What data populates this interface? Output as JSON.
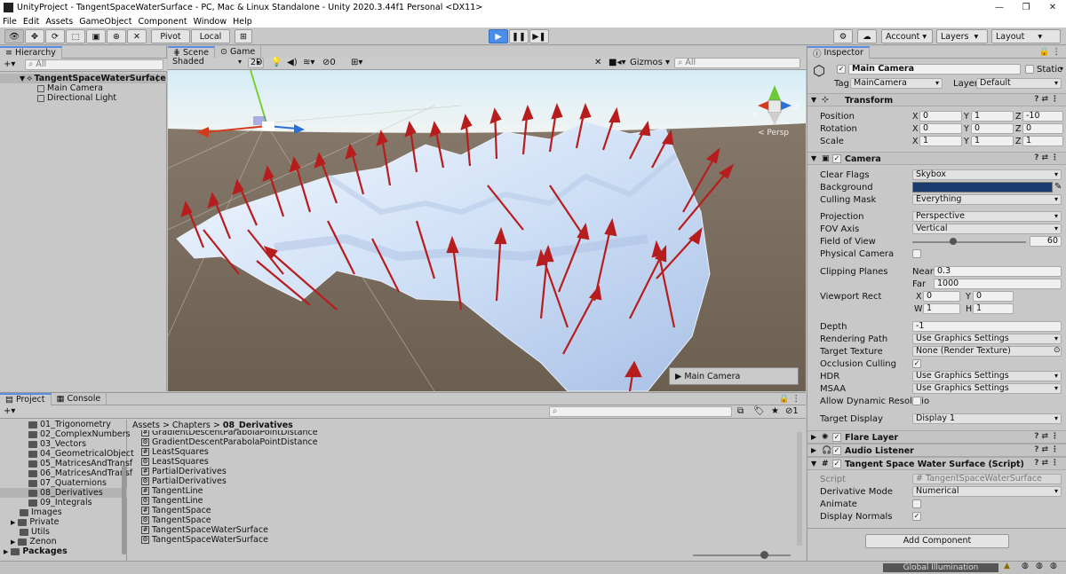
{
  "window": {
    "title": "UnityProject - TangentSpaceWaterSurface - PC, Mac & Linux Standalone - Unity 2020.3.44f1 Personal <DX11>",
    "controls": [
      "—",
      "❐",
      "✕"
    ]
  },
  "menu": [
    "File",
    "Edit",
    "Assets",
    "GameObject",
    "Component",
    "Window",
    "Help"
  ],
  "toolbar": {
    "pivot": "Pivot",
    "local": "Local",
    "account": "Account",
    "layers": "Layers",
    "layout": "Layout"
  },
  "hierarchy": {
    "tab": "Hierarchy",
    "search_placeholder": "All",
    "scene_name": "TangentSpaceWaterSurface",
    "items": [
      "Main Camera",
      "Directional Light"
    ]
  },
  "scene": {
    "tabs": [
      "Scene",
      "Game"
    ],
    "shading": "Shaded",
    "mode_2d": "2D",
    "hidden_count": "0",
    "gizmos": "Gizmos",
    "search_placeholder": "All",
    "persp": "< Persp",
    "camera_preview": "Main Camera",
    "axis_x": "x",
    "axis_z": "z"
  },
  "inspector": {
    "tab": "Inspector",
    "object_name": "Main Camera",
    "static_label": "Static",
    "tag_label": "Tag",
    "tag_value": "MainCamera",
    "layer_label": "Layer",
    "layer_value": "Default",
    "transform": {
      "header": "Transform",
      "position_label": "Position",
      "position": [
        "0",
        "1",
        "-10"
      ],
      "rotation_label": "Rotation",
      "rotation": [
        "0",
        "0",
        "0"
      ],
      "scale_label": "Scale",
      "scale": [
        "1",
        "1",
        "1"
      ],
      "axes": [
        "X",
        "Y",
        "Z"
      ]
    },
    "camera": {
      "header": "Camera",
      "clear_flags_label": "Clear Flags",
      "clear_flags": "Skybox",
      "background_label": "Background",
      "background_color": "#1a3a6e",
      "culling_mask_label": "Culling Mask",
      "culling_mask": "Everything",
      "projection_label": "Projection",
      "projection": "Perspective",
      "fov_axis_label": "FOV Axis",
      "fov_axis": "Vertical",
      "fov_label": "Field of View",
      "fov": "60",
      "physical_label": "Physical Camera",
      "clipping_label": "Clipping Planes",
      "near_label": "Near",
      "near": "0.3",
      "far_label": "Far",
      "far": "1000",
      "viewport_label": "Viewport Rect",
      "vx_label": "X",
      "vx": "0",
      "vy_label": "Y",
      "vy": "0",
      "vw_label": "W",
      "vw": "1",
      "vh_label": "H",
      "vh": "1",
      "depth_label": "Depth",
      "depth": "-1",
      "rendering_path_label": "Rendering Path",
      "rendering_path": "Use Graphics Settings",
      "target_texture_label": "Target Texture",
      "target_texture": "None (Render Texture)",
      "occlusion_label": "Occlusion Culling",
      "hdr_label": "HDR",
      "hdr": "Use Graphics Settings",
      "msaa_label": "MSAA",
      "msaa": "Use Graphics Settings",
      "dyn_res_label": "Allow Dynamic Resolutio",
      "target_display_label": "Target Display",
      "target_display": "Display 1"
    },
    "flare_layer": "Flare Layer",
    "audio_listener": "Audio Listener",
    "script": {
      "header": "Tangent Space Water Surface (Script)",
      "script_label": "Script",
      "script_value": "TangentSpaceWaterSurface",
      "derivative_label": "Derivative Mode",
      "derivative_value": "Numerical",
      "animate_label": "Animate",
      "normals_label": "Display Normals"
    },
    "add_component": "Add Component"
  },
  "project": {
    "tabs": [
      "Project",
      "Console"
    ],
    "folders": [
      "01_Trigonometry",
      "02_ComplexNumbers",
      "03_Vectors",
      "04_GeometricalObject",
      "05_MatricesAndTransf",
      "06_MatricesAndTransf",
      "07_Quaternions",
      "08_Derivatives",
      "09_Integrals"
    ],
    "top_folders": [
      "Images",
      "Private",
      "Utils",
      "Zenon"
    ],
    "packages": "Packages",
    "breadcrumb": [
      "Assets",
      "Chapters",
      "08_Derivatives"
    ],
    "files": [
      {
        "icon": "#",
        "name": "GradientDescentParabolaPointDistance"
      },
      {
        "icon": "⚙",
        "name": "GradientDescentParabolaPointDistance"
      },
      {
        "icon": "#",
        "name": "LeastSquares"
      },
      {
        "icon": "⚙",
        "name": "LeastSquares"
      },
      {
        "icon": "#",
        "name": "PartialDerivatives"
      },
      {
        "icon": "⚙",
        "name": "PartialDerivatives"
      },
      {
        "icon": "#",
        "name": "TangentLine"
      },
      {
        "icon": "⚙",
        "name": "TangentLine"
      },
      {
        "icon": "#",
        "name": "TangentSpace"
      },
      {
        "icon": "⚙",
        "name": "TangentSpace"
      },
      {
        "icon": "#",
        "name": "TangentSpaceWaterSurface"
      },
      {
        "icon": "⚙",
        "name": "TangentSpaceWaterSurface"
      }
    ],
    "hidden_count": "1"
  },
  "status": {
    "global_illumination": "Global Illumination"
  }
}
